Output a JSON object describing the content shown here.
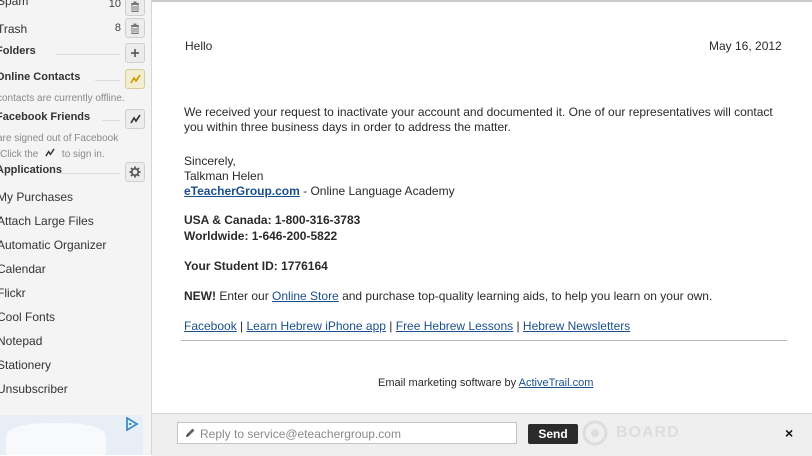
{
  "sidebar": {
    "folders": [
      {
        "label": "Spam",
        "count": "10"
      },
      {
        "label": "Trash",
        "count": "8"
      }
    ],
    "sections": {
      "folders": {
        "title": "Folders"
      },
      "online_contacts": {
        "title": "Online Contacts",
        "note": "contacts are currently offline."
      },
      "facebook_friends": {
        "title": "Facebook Friends",
        "note1": "are signed out of Facebook",
        "note2": "Click the",
        "note3": "to sign in."
      },
      "applications": {
        "title": "Applications"
      }
    },
    "apps": [
      "My Purchases",
      "Attach Large Files",
      "Automatic Organizer",
      "Calendar",
      "Flickr",
      "Cool Fonts",
      "Notepad",
      "Stationery",
      "Unsubscriber"
    ]
  },
  "email": {
    "greeting": "Hello",
    "date": "May 16, 2012",
    "body_line1": "We received your request to inactivate your account and documented it. One of our representatives will contact",
    "body_line2": "you within three business days in order to address the matter.",
    "sincerely": "Sincerely,",
    "signer": "Talkman Helen",
    "company_link": "eTeacherGroup.com",
    "company_suffix": " - Online Language Academy",
    "phone_us": "USA & Canada: 1-800-316-3783",
    "phone_world": "Worldwide: 1-646-200-5822",
    "student_id": "Your Student ID: 1776164",
    "promo_new": "NEW!",
    "promo_pre": " Enter our ",
    "promo_link": "Online Store",
    "promo_post": " and purchase top-quality learning aids, to help you learn on your own.",
    "footer_links": [
      "Facebook",
      "Learn Hebrew iPhone app",
      "Free Hebrew Lessons",
      "Hebrew Newsletters"
    ],
    "footer_sep": " | ",
    "marketing_pre": "Email marketing software by ",
    "marketing_link": "ActiveTrail.com"
  },
  "reply": {
    "placeholder": "Reply to service@eteachergroup.com",
    "send_label": "Send",
    "close_label": "×"
  },
  "watermark": {
    "text": "BOARD"
  },
  "colors": {
    "link": "#1a4f8c",
    "send_bg": "#2b2b2b",
    "sidebar_bg": "#f4f4f4"
  }
}
